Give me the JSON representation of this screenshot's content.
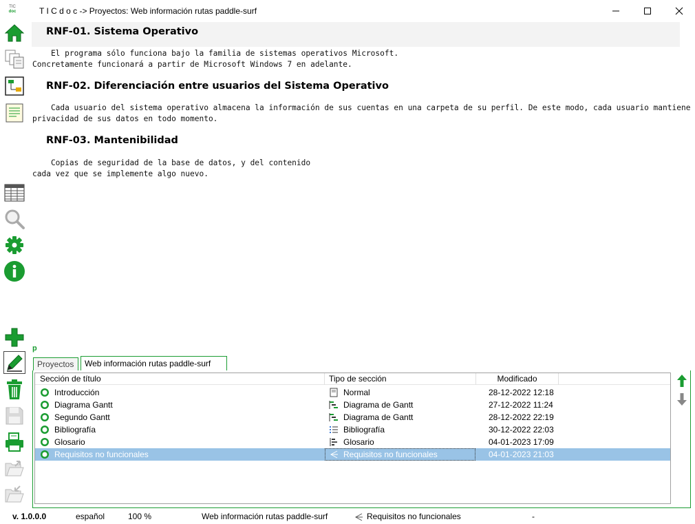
{
  "window": {
    "logo_top": "TIC",
    "logo_bottom": "doc",
    "title": "T I C d o c -> Proyectos: Web información rutas paddle-surf"
  },
  "toolbar": {
    "icons": [
      "home-icon",
      "copy-pages-icon",
      "diagram-icon",
      "notes-icon",
      "table-icon",
      "search-icon",
      "gear-icon",
      "info-icon",
      "add-icon",
      "edit-icon",
      "delete-icon",
      "save-icon",
      "print-icon",
      "export-icon",
      "import-icon"
    ]
  },
  "document": {
    "sections": [
      {
        "heading": "RNF-01. Sistema Operativo",
        "lines": [
          "    El programa sólo funciona bajo la familia de sistemas operativos Microsoft.",
          "Concretamente funcionará a partir de Microsoft Windows 7 en adelante."
        ]
      },
      {
        "heading": "RNF-02. Diferenciación entre usuarios del Sistema Operativo",
        "lines": [
          "    Cada usuario del sistema operativo almacena la información de sus cuentas en una carpeta de su perfil. De este modo, cada usuario mantiene la",
          "privacidad de sus datos en todo momento."
        ]
      },
      {
        "heading": "RNF-03. Mantenibilidad",
        "lines": [
          "    Copias de seguridad de la base de datos, y del contenido",
          "cada vez que se implemente algo nuevo."
        ]
      }
    ]
  },
  "marker": "p",
  "tabs": [
    {
      "label": "Proyectos",
      "active": false
    },
    {
      "label": "Web información rutas paddle-surf",
      "active": true
    }
  ],
  "grid": {
    "columns": [
      "Sección de título",
      "Tipo de sección",
      "Modificado"
    ],
    "rows": [
      {
        "title": "Introducción",
        "type": "Normal",
        "type_icon": "page-icon",
        "modified": "28-12-2022 12:18",
        "selected": false
      },
      {
        "title": "Diagrama Gantt",
        "type": "Diagrama de Gantt",
        "type_icon": "gantt-icon",
        "modified": "27-12-2022 11:24",
        "selected": false
      },
      {
        "title": "Segundo Gantt",
        "type": "Diagrama de Gantt",
        "type_icon": "gantt-icon",
        "modified": "28-12-2022 22:19",
        "selected": false
      },
      {
        "title": "Bibliografía",
        "type": "Bibliografía",
        "type_icon": "list-icon",
        "modified": "30-12-2022 22:03",
        "selected": false
      },
      {
        "title": "Glosario",
        "type": "Glosario",
        "type_icon": "glossary-icon",
        "modified": "04-01-2023 17:09",
        "selected": false
      },
      {
        "title": "Requisitos no funcionales",
        "type": "Requisitos no funcionales",
        "type_icon": "requirements-icon",
        "modified": "04-01-2023 21:03",
        "selected": true
      }
    ]
  },
  "status": {
    "version": "v. 1.0.0.0",
    "language": "español",
    "zoom": "100 %",
    "project": "Web información rutas paddle-surf",
    "section": "Requisitos no funcionales",
    "extra": "-"
  },
  "colors": {
    "accent": "#1a9c31",
    "selection": "#99c3e6"
  }
}
